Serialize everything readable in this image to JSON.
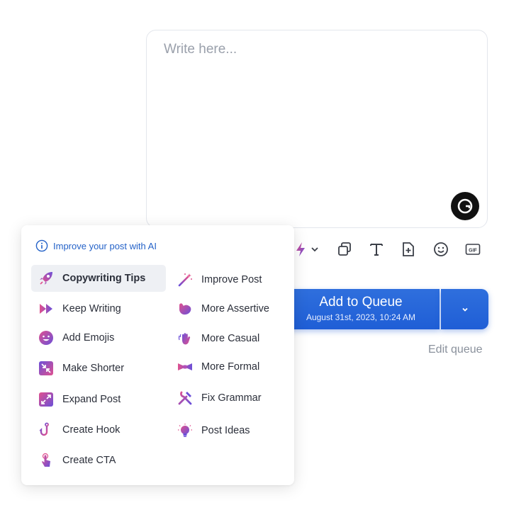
{
  "editor": {
    "placeholder": "Write here..."
  },
  "ai_menu": {
    "header": "Improve your post with AI",
    "left_items": [
      {
        "label": "Copywriting Tips",
        "icon": "rocket-icon"
      },
      {
        "label": "Keep Writing",
        "icon": "fast-forward-icon"
      },
      {
        "label": "Add Emojis",
        "icon": "smiley-icon"
      },
      {
        "label": "Make Shorter",
        "icon": "shrink-icon"
      },
      {
        "label": "Expand Post",
        "icon": "expand-icon"
      },
      {
        "label": "Create Hook",
        "icon": "hook-icon"
      },
      {
        "label": "Create CTA",
        "icon": "pointer-icon"
      }
    ],
    "right_items": [
      {
        "label": "Improve Post",
        "icon": "magic-wand-icon"
      },
      {
        "label": "More Assertive",
        "icon": "flexed-arm-icon"
      },
      {
        "label": "More Casual",
        "icon": "waving-hand-icon"
      },
      {
        "label": "More Formal",
        "icon": "bow-tie-icon"
      },
      {
        "label": "Fix Grammar",
        "icon": "tools-icon"
      },
      {
        "label": "Post Ideas",
        "icon": "lightbulb-icon"
      }
    ]
  },
  "queue_button": {
    "title": "Add to Queue",
    "subtitle": "August 31st, 2023, 10:24 AM"
  },
  "edit_queue": "Edit queue",
  "colors": {
    "accent": "#1f5ed6",
    "icon_gradient_start": "#e0518f",
    "icon_gradient_end": "#6b4fd8"
  }
}
